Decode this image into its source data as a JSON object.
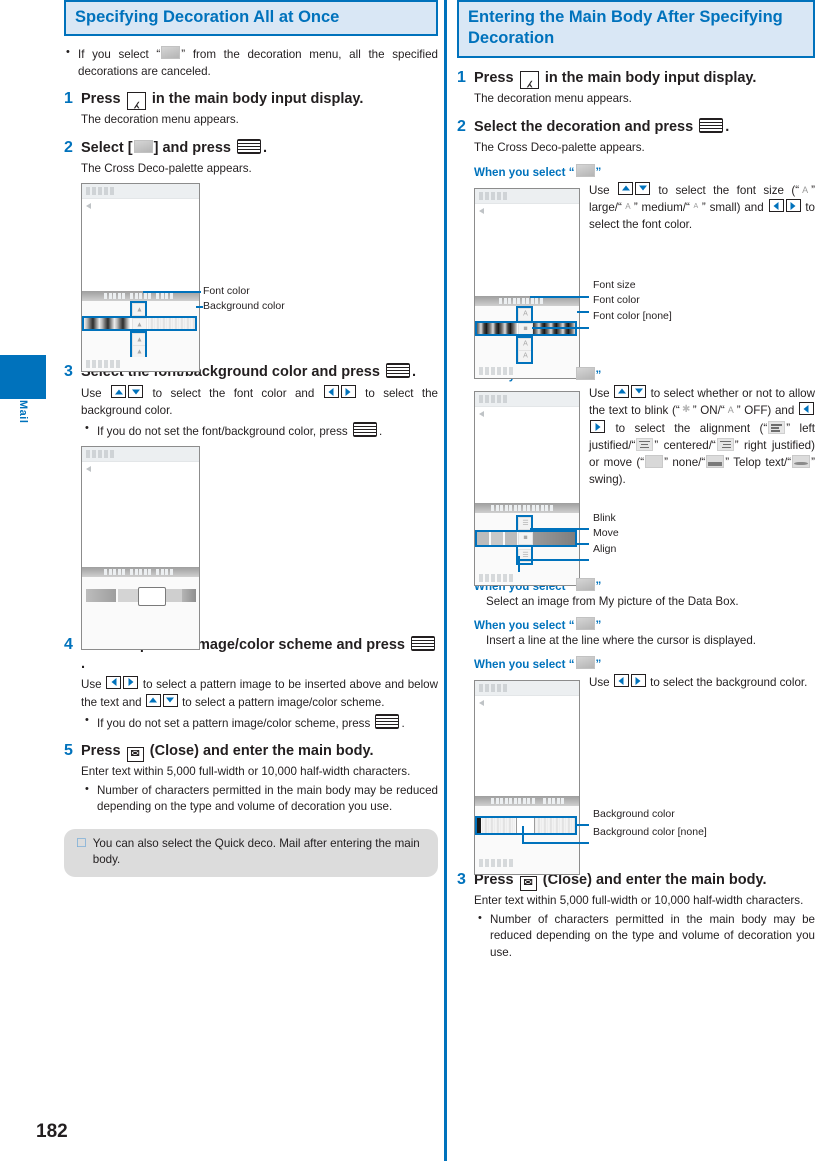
{
  "page": {
    "number": "182",
    "side_tab_label": "Mail",
    "accent_color": "#0072bc",
    "heading_bg": "#d9e7f5"
  },
  "left": {
    "heading": "Specifying Decoration All at Once",
    "intro_bullet": {
      "pre": "If you select “",
      "icon": "deco-cancel-icon",
      "post": "” from the decoration menu, all the specified decorations are canceled."
    },
    "steps": [
      {
        "num": "1",
        "title_pre": "Press",
        "key": "call-key",
        "title_post": "in the main body input display.",
        "desc": "The decoration menu appears."
      },
      {
        "num": "2",
        "title_pre": "Select [",
        "icon": "deco-all-icon",
        "title_mid": "] and press",
        "key": "select-key",
        "title_post": ".",
        "desc": "The Cross Deco-palette appears."
      },
      {
        "num": "3",
        "title_pre": "Select the font/background color and press",
        "key": "select-key",
        "title_post": ".",
        "desc_a": "Use",
        "desc_b": "to select the font color and",
        "desc_c": "to select the background color.",
        "sub_bullet_a": "If you do not set the font/background color, press",
        "sub_bullet_b": "."
      },
      {
        "num": "4",
        "title_pre": "Select a pattern image/color scheme and press",
        "key": "select-key",
        "title_post": ".",
        "desc_a": "Use",
        "desc_b": "to select a pattern image to be inserted above and below the text and",
        "desc_c": "to select a pattern image/color scheme.",
        "sub_bullet_a": "If you do not set a pattern image/color scheme, press",
        "sub_bullet_b": "."
      },
      {
        "num": "5",
        "title_pre": "Press",
        "key": "mail-key",
        "title_post": "(Close) and enter the main body.",
        "desc": "Enter text within 5,000 full-width or 10,000 half-width characters.",
        "sub_bullet": "Number of characters permitted in the main body may be reduced depending on the type and volume of decoration you use."
      }
    ],
    "mock1_labels": [
      "Font color",
      "Background color"
    ],
    "note": "You can also select the Quick deco. Mail after entering the main body."
  },
  "right": {
    "heading": "Entering the Main Body After Specifying Decoration",
    "steps": [
      {
        "num": "1",
        "title_pre": "Press",
        "key": "call-key",
        "title_post": "in the main body input display.",
        "desc": "The decoration menu appears."
      },
      {
        "num": "2",
        "title_pre": "Select the decoration and press",
        "key": "select-key",
        "title_post": ".",
        "desc": "The Cross Deco-palette appears."
      },
      {
        "num": "3",
        "title_pre": "Press",
        "key": "mail-key",
        "title_post": "(Close) and enter the main body.",
        "desc": "Enter text within 5,000 full-width or 10,000 half-width characters.",
        "sub_bullet": "Number of characters permitted in the main body may be reduced depending on the type and volume of decoration you use."
      }
    ],
    "selections": [
      {
        "label": "When you select “",
        "icon": "font-size-color-icon",
        "label_end": "”",
        "note_a": "Use",
        "note_b": "to select the font size (“",
        "note_c": "” large/“",
        "note_d": "” medium/“",
        "note_e": "” small) and",
        "note_f": "to select the font color.",
        "callouts": [
          "Font size",
          "Font color",
          "Font color [none]"
        ]
      },
      {
        "label": "When you select “",
        "icon": "blink-move-align-icon",
        "label_end": "”",
        "note_a": "Use",
        "note_b": "to select whether or not to allow the text to blink (“",
        "note_c": "” ON/“",
        "note_d": "” OFF) and",
        "note_e": "to select the alignment (“",
        "note_f": "” left justified/“",
        "note_g": "” centered/“",
        "note_h": "” right justified) or move (“",
        "note_i": "” none/“",
        "note_j": "” Telop text/“",
        "note_k": "” swing).",
        "callouts": [
          "Blink",
          "Move",
          "Align"
        ]
      },
      {
        "label": "When you select “",
        "icon": "insert-image-icon",
        "label_end": "”",
        "body": "Select an image from My picture of the Data Box."
      },
      {
        "label": "When you select “",
        "icon": "insert-line-icon",
        "label_end": "”",
        "body": "Insert a line at the line where the cursor is displayed."
      },
      {
        "label": "When you select “",
        "icon": "background-color-icon",
        "label_end": "”",
        "note_a": "Use",
        "note_b": "to select the background color.",
        "callouts": [
          "Background color",
          "Background color [none]"
        ]
      }
    ]
  }
}
